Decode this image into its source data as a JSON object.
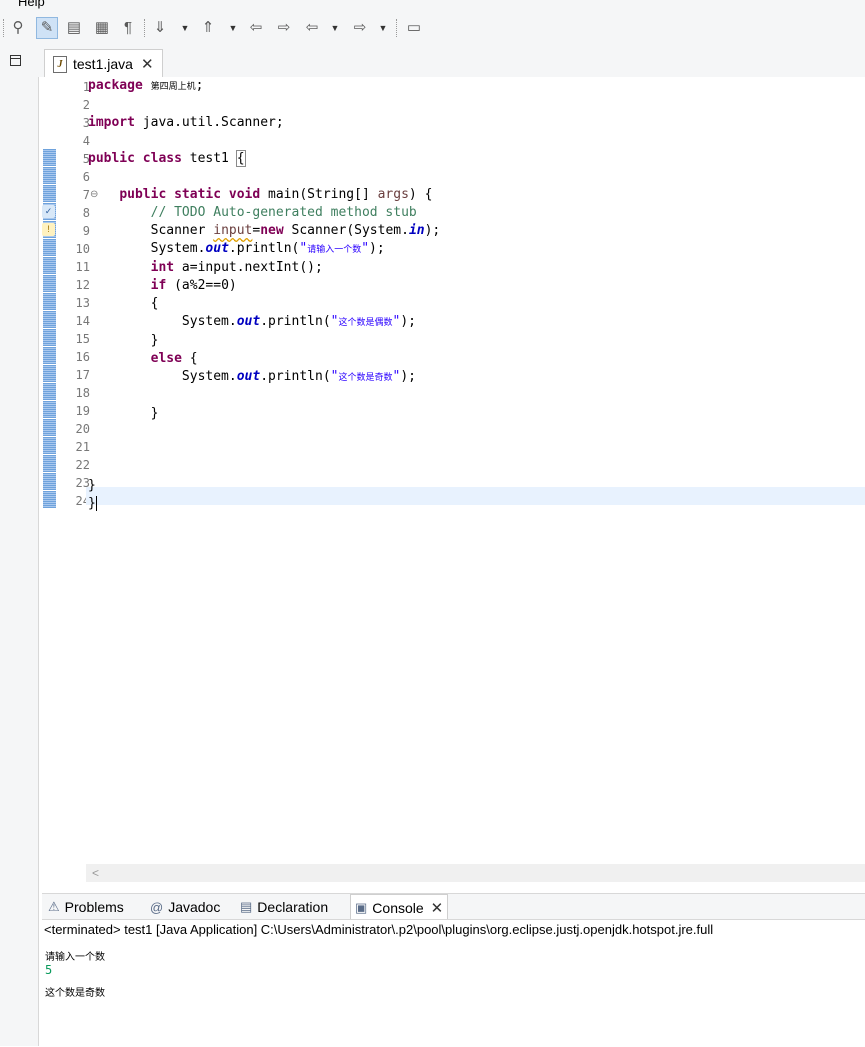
{
  "menu": {
    "help": "Help"
  },
  "toolbar": {
    "icons": [
      "debug-run-icon",
      "highlight-toggle-icon",
      "show-source-icon",
      "block-selection-icon",
      "show-whitespace-icon",
      "next-annotation-icon",
      "previous-annotation-icon",
      "last-edit-location-icon",
      "forward-edit-icon",
      "back-icon",
      "forward-icon",
      "open-task-icon"
    ]
  },
  "editor": {
    "tab_label": "test1.java",
    "lines": [
      {
        "n": "1"
      },
      {
        "n": "2"
      },
      {
        "n": "3"
      },
      {
        "n": "4"
      },
      {
        "n": "5"
      },
      {
        "n": "6"
      },
      {
        "n": "7"
      },
      {
        "n": "8"
      },
      {
        "n": "9"
      },
      {
        "n": "10"
      },
      {
        "n": "11"
      },
      {
        "n": "12"
      },
      {
        "n": "13"
      },
      {
        "n": "14"
      },
      {
        "n": "15"
      },
      {
        "n": "16"
      },
      {
        "n": "17"
      },
      {
        "n": "18"
      },
      {
        "n": "19"
      },
      {
        "n": "20"
      },
      {
        "n": "21"
      },
      {
        "n": "22"
      },
      {
        "n": "23"
      },
      {
        "n": "24"
      }
    ],
    "code": {
      "l1_kw": "package",
      "l1_name": "第四周上机",
      "l3_kw": "import",
      "l3_rest": " java.util.Scanner;",
      "l5_kw": "public class",
      "l5_name": " test1 ",
      "l5_brace": "{",
      "l7_kw1": "public static void",
      "l7_rest": " main(String[] ",
      "l7_args": "args",
      "l7_end": ") {",
      "l8_comment": "// TODO Auto-generated method stub",
      "l9_a": "Scanner ",
      "l9_var": "input",
      "l9_b": "=",
      "l9_new": "new",
      "l9_c": " Scanner(System.",
      "l9_in": "in",
      "l9_d": ");",
      "l10_a": "System.",
      "l10_out": "out",
      "l10_b": ".println(",
      "l10_str": "请输入一个数",
      "l10_c": ");",
      "l11_kw": "int",
      "l11_rest": " a=input.nextInt();",
      "l12_kw": "if",
      "l12_rest": " (a%2==0)",
      "l13": "{",
      "l14_a": "System.",
      "l14_out": "out",
      "l14_b": ".println(",
      "l14_str": "这个数是偶数",
      "l14_c": ");",
      "l15": "}",
      "l16_kw": "else",
      "l16_rest": " {",
      "l17_a": "System.",
      "l17_out": "out",
      "l17_b": ".println(",
      "l17_str": "这个数是奇数",
      "l17_c": ");",
      "l19": "}",
      "l23": "}",
      "l24": "}"
    }
  },
  "views": {
    "problems": "Problems",
    "javadoc": "Javadoc",
    "declaration": "Declaration",
    "console": "Console"
  },
  "console": {
    "description": "<terminated> test1 [Java Application] C:\\Users\\Administrator\\.p2\\pool\\plugins\\org.eclipse.justj.openjdk.hotspot.jre.full",
    "output_prompt": "请输入一个数",
    "input_value": "5",
    "output_result": "这个数是奇数"
  }
}
